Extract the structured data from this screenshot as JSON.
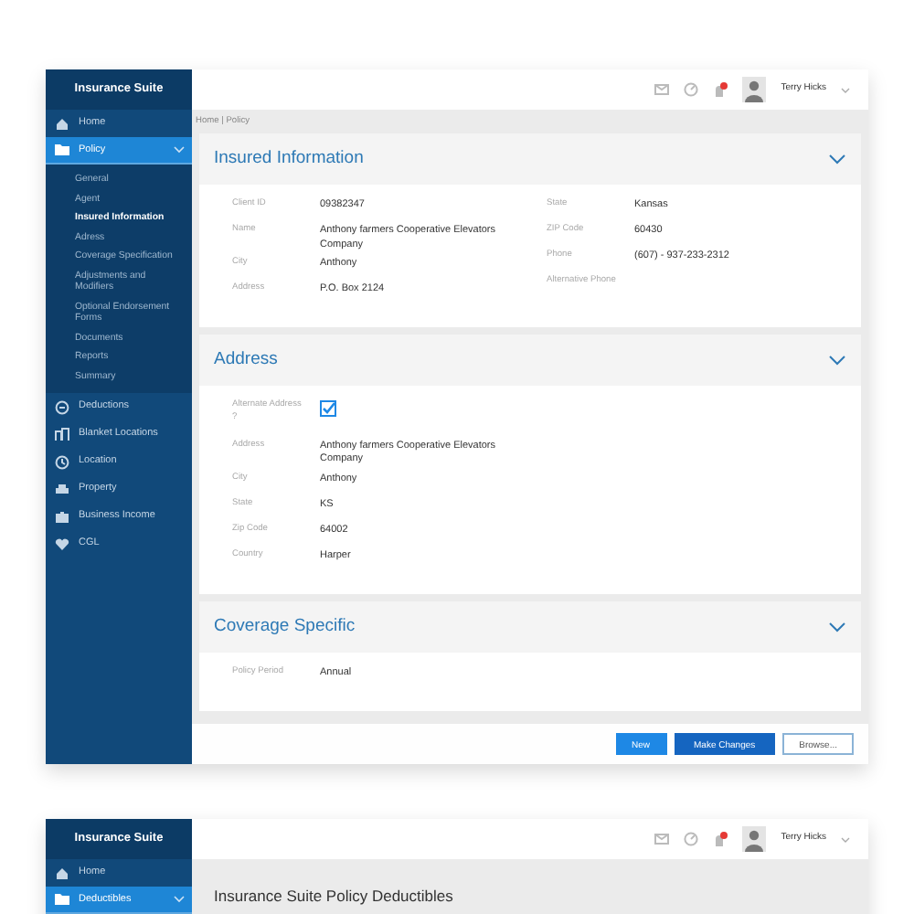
{
  "screens": [
    {
      "app_title": "Insurance Suite",
      "sidebar": {
        "items": [
          {
            "label": "Home",
            "selected": false
          },
          {
            "label": "Policy",
            "selected": true,
            "expanded": true,
            "children": [
              {
                "label": "General",
                "selected": false
              },
              {
                "label": "Agent",
                "selected": false
              },
              {
                "label": "Insured Information",
                "selected": true
              },
              {
                "label": "Adress",
                "selected": false
              },
              {
                "label": "Coverage Specification",
                "selected": false
              },
              {
                "label": "Adjustments and Modifiers",
                "selected": false
              },
              {
                "label": "Optional Endorsement Forms",
                "selected": false
              },
              {
                "label": "Documents",
                "selected": false
              },
              {
                "label": "Reports",
                "selected": false
              },
              {
                "label": "Summary",
                "selected": false
              }
            ]
          },
          {
            "label": "Deductions",
            "selected": false
          },
          {
            "label": "Blanket Locations",
            "selected": false
          },
          {
            "label": "Location",
            "selected": false
          },
          {
            "label": "Property",
            "selected": false
          },
          {
            "label": "Business Income",
            "selected": false
          },
          {
            "label": "CGL",
            "selected": false
          }
        ]
      },
      "header": {
        "user_name": "Terry Hicks",
        "has_notifications": true
      },
      "breadcrumb": "Home | Policy",
      "sections": [
        {
          "title": "Insured Information",
          "expanded": true,
          "columns": [
            [
              {
                "kind": "text",
                "label": "Client ID",
                "value": "09382347"
              },
              {
                "kind": "text",
                "label": "Name",
                "value": "Anthony farmers Cooperative Elevators Company"
              },
              {
                "kind": "text",
                "label": "City",
                "value": "Anthony"
              },
              {
                "kind": "text",
                "label": "Address",
                "value": "P.O. Box 2124"
              }
            ],
            [
              {
                "kind": "text",
                "label": "State",
                "value": "Kansas"
              },
              {
                "kind": "text",
                "label": "ZIP Code",
                "value": "60430"
              },
              {
                "kind": "text",
                "label": "Phone",
                "value": "(607) - 937-233-2312"
              },
              {
                "kind": "text",
                "label": "Alternative Phone"
              }
            ]
          ]
        },
        {
          "title": "Address",
          "expanded": true,
          "columns": [
            [
              {
                "kind": "checkbox",
                "label": "Alternate Address ?",
                "checked": true
              },
              {
                "kind": "text",
                "label": "Address",
                "value": "Anthony farmers Cooperative Elevators Company"
              },
              {
                "kind": "text",
                "label": "City",
                "value": "Anthony"
              },
              {
                "kind": "text",
                "label": "State",
                "value": "KS"
              },
              {
                "kind": "text",
                "label": "Zip Code",
                "value": "64002"
              },
              {
                "kind": "text",
                "label": "Country",
                "value": "Harper"
              }
            ]
          ]
        },
        {
          "title": "Coverage Specific",
          "expanded": true,
          "columns": [
            [
              {
                "kind": "text",
                "label": "Policy Period",
                "value": "Annual"
              }
            ]
          ]
        }
      ],
      "actions": [
        {
          "label": "New",
          "kind": "primary"
        },
        {
          "label": "Make Changes",
          "kind": "secondary"
        },
        {
          "label": "Browse...",
          "kind": "outline"
        }
      ]
    },
    {
      "app_title": "Insurance Suite",
      "sidebar": {
        "items": [
          {
            "label": "Home",
            "selected": false
          },
          {
            "label": "Deductibles",
            "selected": true,
            "expanded": true
          }
        ]
      },
      "header": {
        "user_name": "Terry Hicks",
        "has_notifications": true
      },
      "page_title": "Insurance Suite Policy Deductibles"
    }
  ]
}
